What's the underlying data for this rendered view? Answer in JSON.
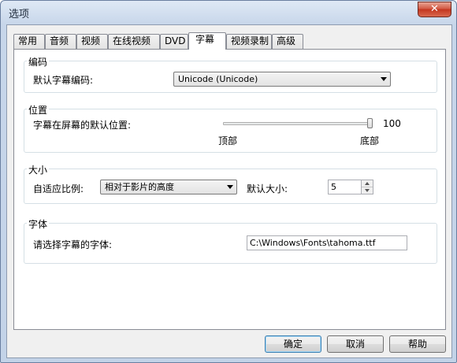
{
  "window": {
    "title": "选项",
    "close_glyph": "✕"
  },
  "tabs": [
    {
      "label": "常用",
      "active": false
    },
    {
      "label": "音频",
      "active": false
    },
    {
      "label": "视频",
      "active": false
    },
    {
      "label": "在线视频",
      "active": false
    },
    {
      "label": "DVD",
      "active": false
    },
    {
      "label": "字幕",
      "active": true
    },
    {
      "label": "视频录制",
      "active": false
    },
    {
      "label": "高级",
      "active": false
    }
  ],
  "encoding": {
    "title": "编码",
    "label": "默认字幕编码:",
    "selected": "Unicode (Unicode)"
  },
  "position": {
    "title": "位置",
    "label": "字幕在屏幕的默认位置:",
    "value": "100",
    "value_fraction": 1.0,
    "min_label": "顶部",
    "max_label": "底部"
  },
  "size": {
    "title": "大小",
    "adapt_label": "自适应比例:",
    "adapt_selected": "相对于影片的高度",
    "default_size_label": "默认大小:",
    "default_size_value": "5"
  },
  "font": {
    "title": "字体",
    "label": "请选择字幕的字体:",
    "path": "C:\\Windows\\Fonts\\tahoma.ttf"
  },
  "buttons": {
    "ok": "确定",
    "cancel": "取消",
    "help": "帮助"
  }
}
